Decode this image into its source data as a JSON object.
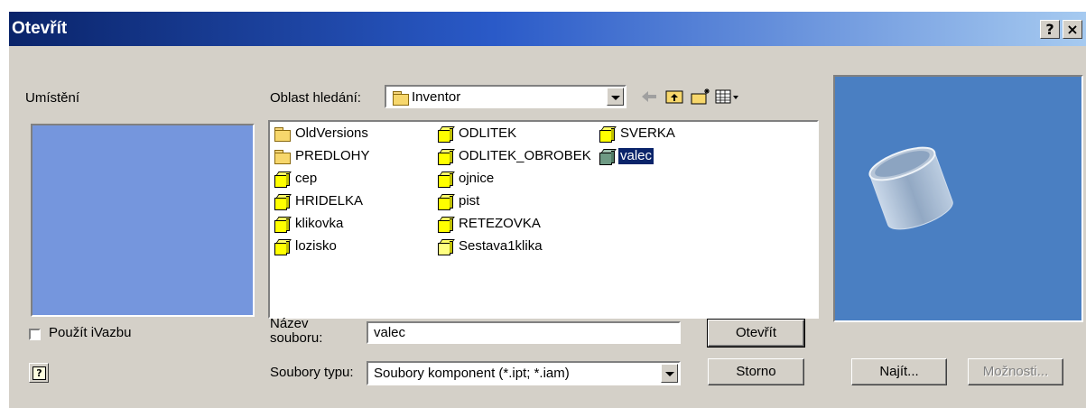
{
  "window": {
    "title": "Otevřít",
    "help_glyph": "?",
    "close_glyph": "×"
  },
  "location": {
    "label": "Umístění"
  },
  "search": {
    "label": "Oblast hledání:",
    "value": "Inventor"
  },
  "toolbar": {
    "back_icon": "back-arrow-icon",
    "up_icon": "up-folder-icon",
    "new_folder_icon": "new-folder-icon",
    "view_icon": "view-menu-icon"
  },
  "files": {
    "col1": [
      {
        "name": "OldVersions",
        "type": "folder"
      },
      {
        "name": "PREDLOHY",
        "type": "folder"
      },
      {
        "name": "cep",
        "type": "part"
      },
      {
        "name": "HRIDELKA",
        "type": "part"
      },
      {
        "name": "klikovka",
        "type": "part"
      },
      {
        "name": "lozisko",
        "type": "part"
      }
    ],
    "col2": [
      {
        "name": "ODLITEK",
        "type": "part"
      },
      {
        "name": "ODLITEK_OBROBEK",
        "type": "part"
      },
      {
        "name": "ojnice",
        "type": "part"
      },
      {
        "name": "pist",
        "type": "part"
      },
      {
        "name": "RETEZOVKA",
        "type": "part"
      },
      {
        "name": "Sestava1klika",
        "type": "assembly"
      }
    ],
    "col3": [
      {
        "name": "SVERKA",
        "type": "part"
      },
      {
        "name": "valec",
        "type": "part",
        "selected": true
      }
    ]
  },
  "filename": {
    "label_line1": "Název",
    "label_line2": "souboru:",
    "value": "valec"
  },
  "filetype": {
    "label": "Soubory typu:",
    "value": "Soubory komponent (*.ipt; *.iam)"
  },
  "buttons": {
    "open": "Otevřít",
    "cancel": "Storno",
    "find": "Najít...",
    "options": "Možnosti..."
  },
  "checkbox": {
    "label": "Použít iVazbu"
  },
  "colors": {
    "title_start": "#0a246a",
    "title_end": "#a6caf0",
    "dialog_bg": "#d4d0c8",
    "selection": "#0a246a",
    "preview_bg": "#4a7fc2",
    "location_bg": "#7596dd"
  }
}
